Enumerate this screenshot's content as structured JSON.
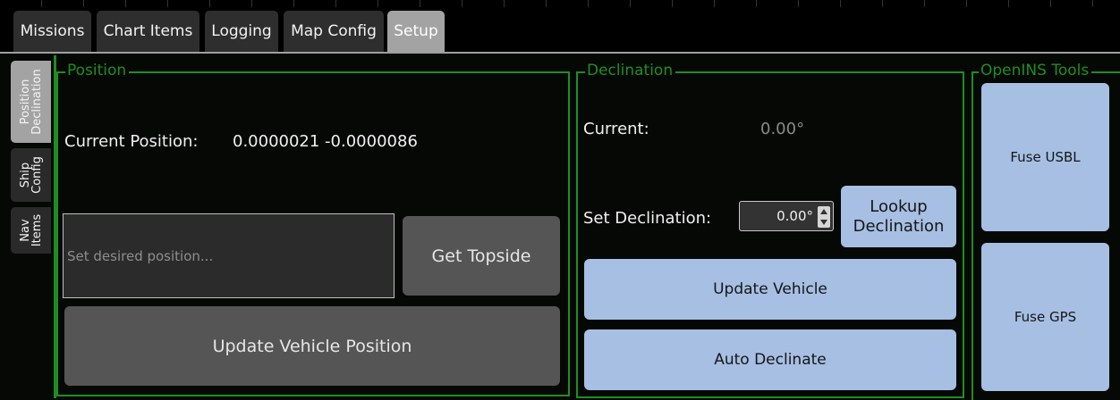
{
  "tabs": [
    "Missions",
    "Chart Items",
    "Logging",
    "Map Config",
    "Setup"
  ],
  "side_tabs": [
    "Position\nDeclination",
    "Ship\nConfig",
    "Nav\nItems"
  ],
  "position": {
    "title": "Position",
    "current_label": "Current Position:",
    "current_value": "0.0000021 -0.0000086",
    "input_placeholder": "Set desired position...",
    "get_topside": "Get Topside",
    "update_vehicle_position": "Update Vehicle Position"
  },
  "declination": {
    "title": "Declination",
    "current_label": "Current:",
    "current_value": "0.00°",
    "set_label": "Set Declination:",
    "set_value": "0.00°",
    "lookup": "Lookup\nDeclination",
    "update_vehicle": "Update Vehicle",
    "auto_declinate": "Auto Declinate"
  },
  "openins": {
    "title": "OpenINS Tools",
    "fuse_usbl": "Fuse USBL",
    "fuse_gps": "Fuse GPS"
  },
  "colors": {
    "group_border": "#1f8f1f",
    "blue_button": "#a6bfe3",
    "gray_button": "#555555",
    "active_tab": "#a3a3a3"
  }
}
